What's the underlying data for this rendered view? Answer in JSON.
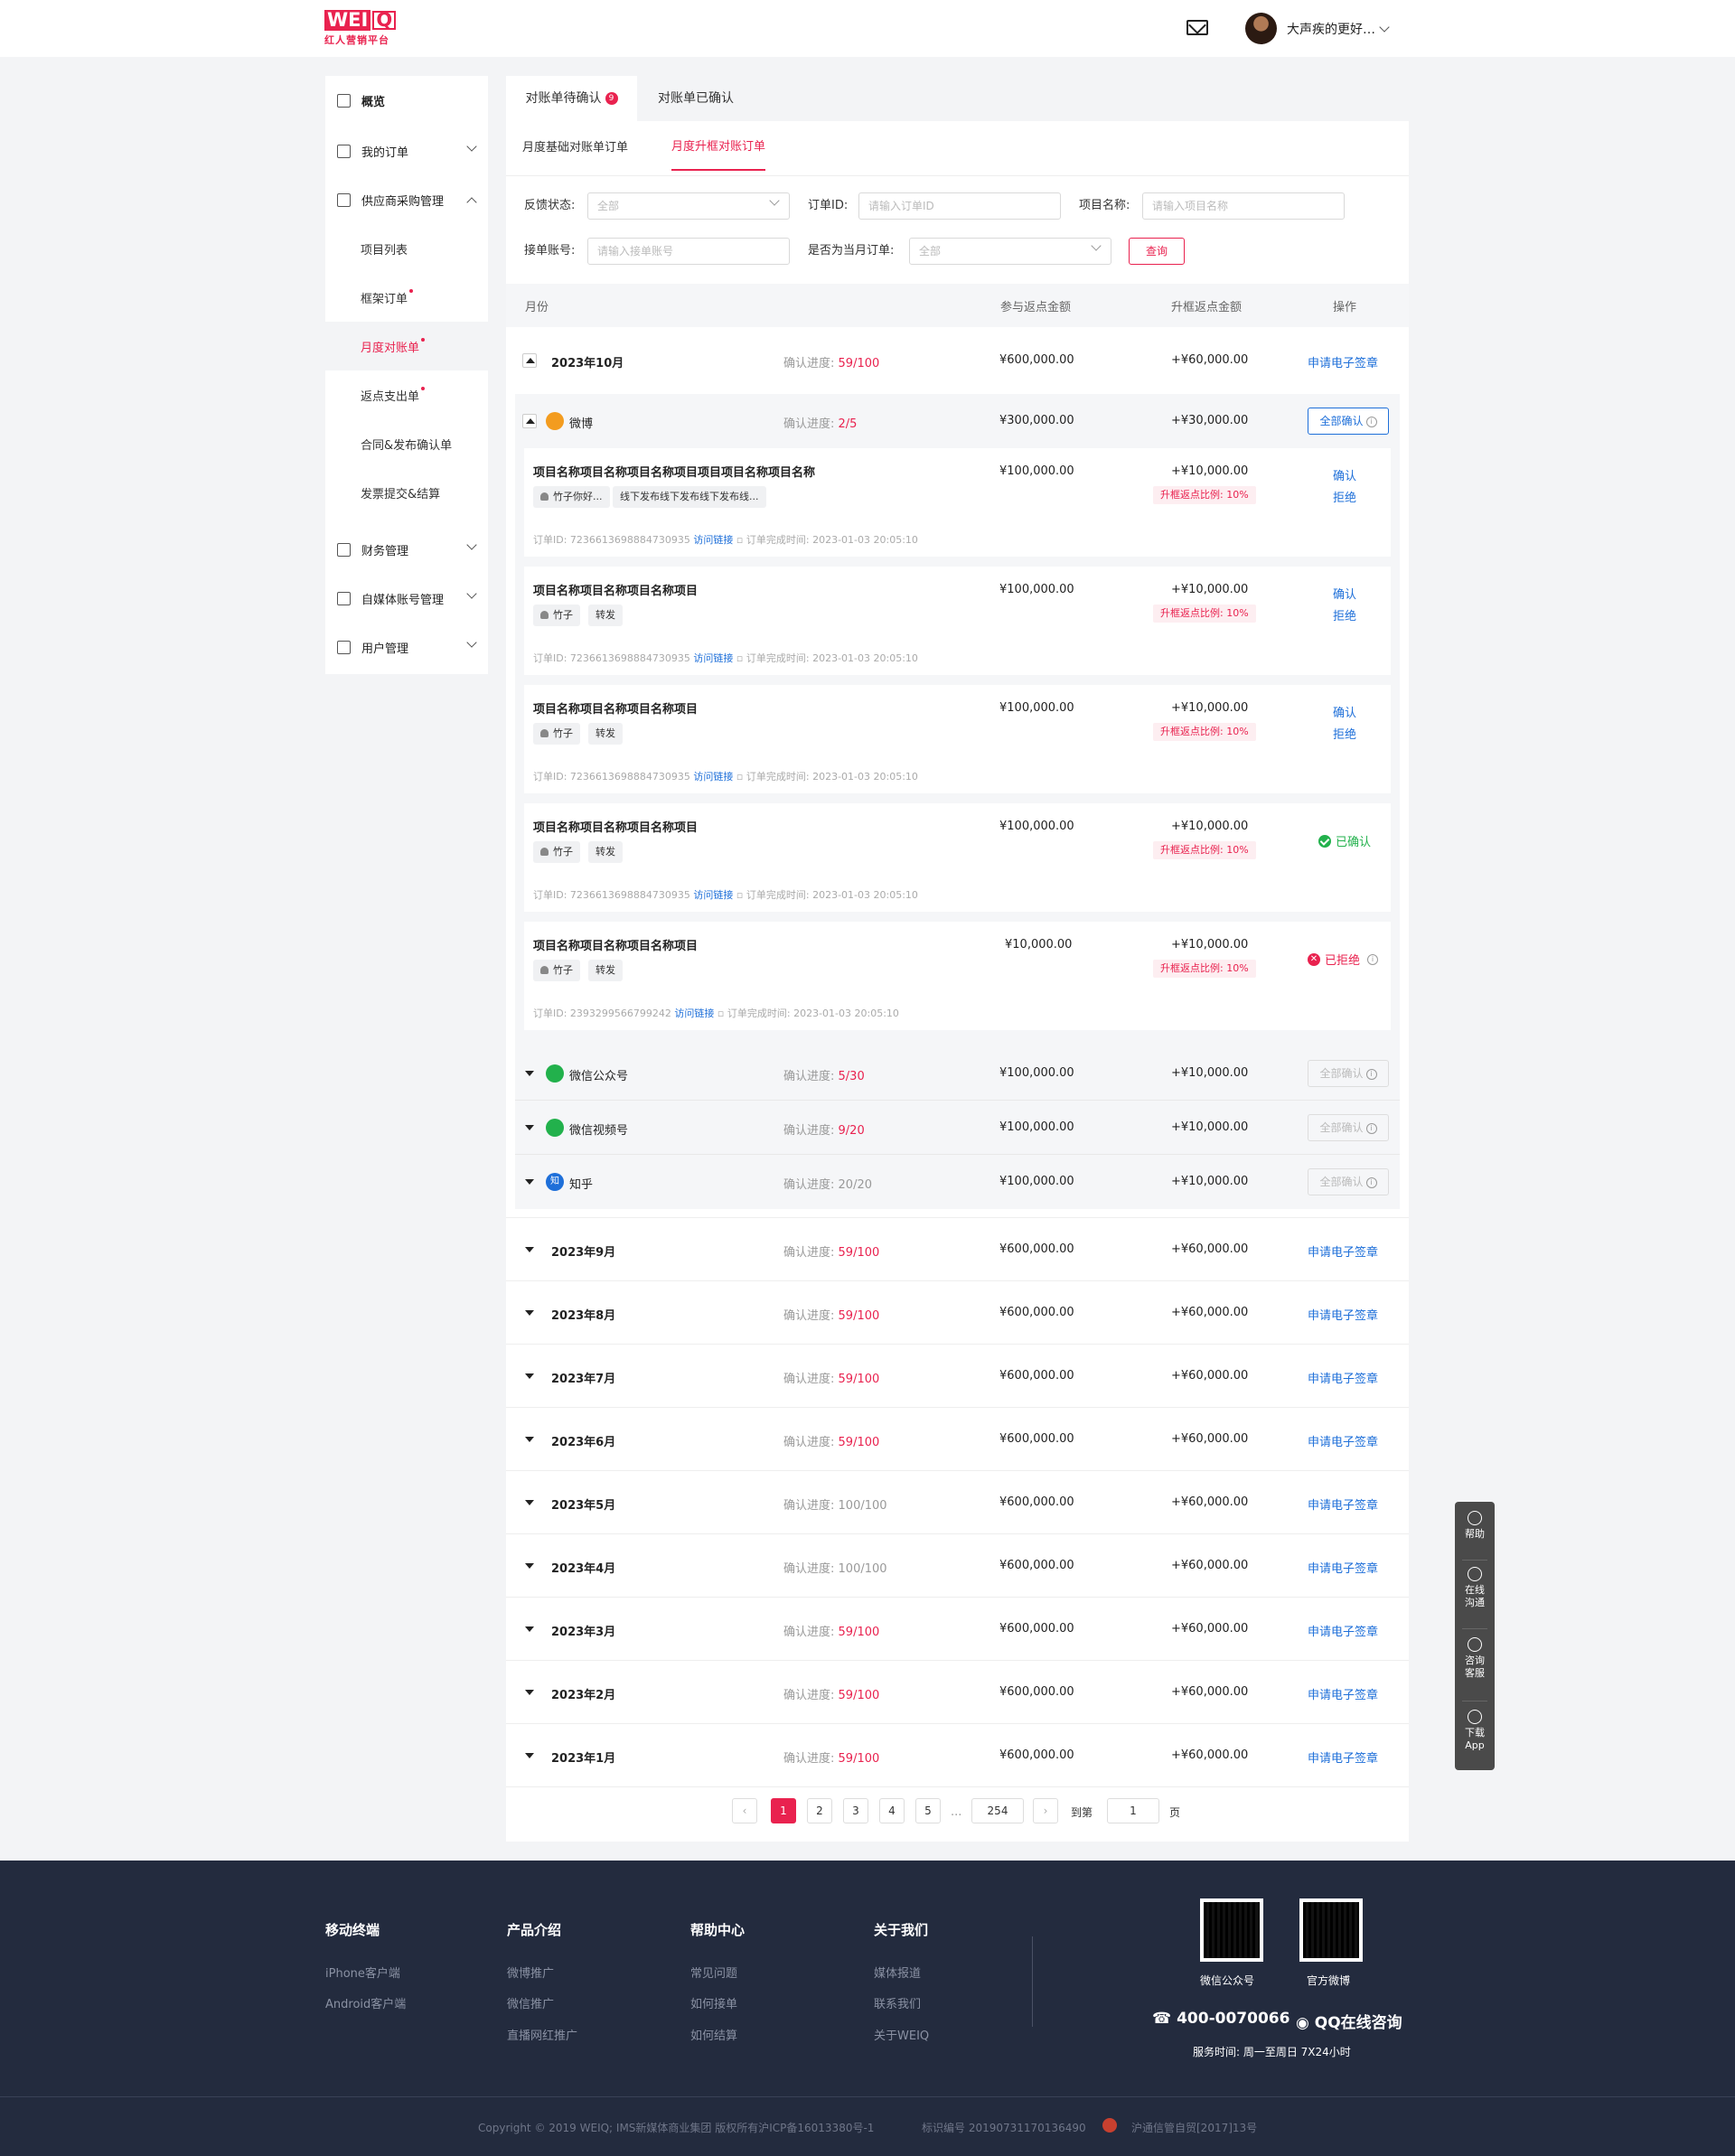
{
  "header": {
    "logo_text": "WEI",
    "logo_q": "Q",
    "logo_sub": "红人营销平台",
    "user_name": "大声疾的更好…"
  },
  "sidebar": {
    "overview": "概览",
    "my_orders": "我的订单",
    "supplier": "供应商采购管理",
    "subs": [
      "项目列表",
      "框架订单",
      "月度对账单",
      "返点支出单",
      "合同&发布确认单",
      "发票提交&结算"
    ],
    "finance": "财务管理",
    "media": "自媒体账号管理",
    "users": "用户管理"
  },
  "tabs": {
    "pending": "对账单待确认",
    "pending_badge": "9",
    "confirmed": "对账单已确认"
  },
  "subtabs": {
    "basic": "月度基础对账单订单",
    "upgrade": "月度升框对账订单"
  },
  "filters": {
    "feedback_label": "反馈状态:",
    "feedback_value": "全部",
    "order_label": "订单ID:",
    "order_ph": "请输入订单ID",
    "project_label": "项目名称:",
    "project_ph": "请输入项目名称",
    "account_label": "接单账号:",
    "account_ph": "请输入接单账号",
    "current_label": "是否为当月订单:",
    "current_value": "全部",
    "query": "查询"
  },
  "table": {
    "col_month": "月份",
    "col_amount": "参与返点金额",
    "col_upgrade": "升框返点金额",
    "col_action": "操作"
  },
  "oct": {
    "month": "2023年10月",
    "progress_label": "确认进度:",
    "progress": "59/100",
    "amount": "¥600,000.00",
    "upgrade": "+¥60,000.00",
    "action": "申请电子签章"
  },
  "weibo": {
    "name": "微博",
    "progress_label": "确认进度:",
    "progress": "2/5",
    "amount": "¥300,000.00",
    "upgrade": "+¥30,000.00",
    "action": "全部确认"
  },
  "items": [
    {
      "title": "项目名称项目名称项目名称项目项目项目名称项目名称",
      "user": "竹子你好...",
      "tag": "线下发布线下发布线下发布线...",
      "id_label": "订单ID:",
      "id": "7236613698884730935",
      "link": "访问链接",
      "time_label": "订单完成时间:",
      "time": "2023-01-03 20:05:10",
      "amount": "¥100,000.00",
      "upgrade": "+¥10,000.00",
      "ratio": "升框返点比例: 10%",
      "confirm": "确认",
      "reject": "拒绝"
    },
    {
      "title": "项目名称项目名称项目名称项目",
      "user": "竹子",
      "tag": "转发",
      "id_label": "订单ID:",
      "id": "7236613698884730935",
      "link": "访问链接",
      "time_label": "订单完成时间:",
      "time": "2023-01-03 20:05:10",
      "amount": "¥100,000.00",
      "upgrade": "+¥10,000.00",
      "ratio": "升框返点比例: 10%",
      "confirm": "确认",
      "reject": "拒绝"
    },
    {
      "title": "项目名称项目名称项目名称项目",
      "user": "竹子",
      "tag": "转发",
      "id_label": "订单ID:",
      "id": "7236613698884730935",
      "link": "访问链接",
      "time_label": "订单完成时间:",
      "time": "2023-01-03 20:05:10",
      "amount": "¥100,000.00",
      "upgrade": "+¥10,000.00",
      "ratio": "升框返点比例: 10%",
      "confirm": "确认",
      "reject": "拒绝"
    },
    {
      "title": "项目名称项目名称项目名称项目",
      "user": "竹子",
      "tag": "转发",
      "id_label": "订单ID:",
      "id": "7236613698884730935",
      "link": "访问链接",
      "time_label": "订单完成时间:",
      "time": "2023-01-03 20:05:10",
      "amount": "¥100,000.00",
      "upgrade": "+¥10,000.00",
      "ratio": "升框返点比例: 10%",
      "status": "已确认"
    },
    {
      "title": "项目名称项目名称项目名称项目",
      "user": "竹子",
      "tag": "转发",
      "id_label": "订单ID:",
      "id": "2393299566799242",
      "link": "访问链接",
      "time_label": "订单完成时间:",
      "time": "2023-01-03 20:05:10",
      "amount": "¥10,000.00",
      "upgrade": "+¥10,000.00",
      "ratio": "升框返点比例: 10%",
      "status": "已拒绝"
    }
  ],
  "groups": [
    {
      "name": "微信公众号",
      "progress_label": "确认进度:",
      "progress": "5/30",
      "amount": "¥100,000.00",
      "upgrade": "+¥10,000.00",
      "action": "全部确认"
    },
    {
      "name": "微信视频号",
      "progress_label": "确认进度:",
      "progress": "9/20",
      "amount": "¥100,000.00",
      "upgrade": "+¥10,000.00",
      "action": "全部确认"
    },
    {
      "name": "知乎",
      "progress_label": "确认进度:",
      "progress": "20/20",
      "amount": "¥100,000.00",
      "upgrade": "+¥10,000.00",
      "action": "全部确认"
    }
  ],
  "zhihu_char": "知",
  "months": [
    {
      "month": "2023年9月",
      "progress_label": "确认进度:",
      "progress": "59/100",
      "amount": "¥600,000.00",
      "upgrade": "+¥60,000.00",
      "action": "申请电子签章"
    },
    {
      "month": "2023年8月",
      "progress_label": "确认进度:",
      "progress": "59/100",
      "amount": "¥600,000.00",
      "upgrade": "+¥60,000.00",
      "action": "申请电子签章"
    },
    {
      "month": "2023年7月",
      "progress_label": "确认进度:",
      "progress": "59/100",
      "amount": "¥600,000.00",
      "upgrade": "+¥60,000.00",
      "action": "申请电子签章"
    },
    {
      "month": "2023年6月",
      "progress_label": "确认进度:",
      "progress": "59/100",
      "amount": "¥600,000.00",
      "upgrade": "+¥60,000.00",
      "action": "申请电子签章"
    },
    {
      "month": "2023年5月",
      "progress_label": "确认进度:",
      "progress": "100/100",
      "amount": "¥600,000.00",
      "upgrade": "+¥60,000.00",
      "action": "申请电子签章"
    },
    {
      "month": "2023年4月",
      "progress_label": "确认进度:",
      "progress": "100/100",
      "amount": "¥600,000.00",
      "upgrade": "+¥60,000.00",
      "action": "申请电子签章"
    },
    {
      "month": "2023年3月",
      "progress_label": "确认进度:",
      "progress": "59/100",
      "amount": "¥600,000.00",
      "upgrade": "+¥60,000.00",
      "action": "申请电子签章"
    },
    {
      "month": "2023年2月",
      "progress_label": "确认进度:",
      "progress": "59/100",
      "amount": "¥600,000.00",
      "upgrade": "+¥60,000.00",
      "action": "申请电子签章"
    },
    {
      "month": "2023年1月",
      "progress_label": "确认进度:",
      "progress": "59/100",
      "amount": "¥600,000.00",
      "upgrade": "+¥60,000.00",
      "action": "申请电子签章"
    }
  ],
  "pager": {
    "pages": [
      "1",
      "2",
      "3",
      "4",
      "5"
    ],
    "ellipsis": "...",
    "last": "254",
    "goto": "到第",
    "input": "1",
    "unit": "页",
    "prev": "‹",
    "next": "›"
  },
  "float": {
    "help": "帮助",
    "chat1": "在线",
    "chat2": "沟通",
    "cs1": "咨询",
    "cs2": "客服",
    "dl1": "下载",
    "dl2": "App"
  },
  "footer": {
    "col1": {
      "title": "移动终端",
      "links": [
        "iPhone客户端",
        "Android客户端"
      ]
    },
    "col2": {
      "title": "产品介绍",
      "links": [
        "微博推广",
        "微信推广",
        "直播网红推广"
      ]
    },
    "col3": {
      "title": "帮助中心",
      "links": [
        "常见问题",
        "如何接单",
        "如何结算"
      ]
    },
    "col4": {
      "title": "关于我们",
      "links": [
        "媒体报道",
        "联系我们",
        "关于WEIQ"
      ]
    },
    "qr1": "微信公众号",
    "qr2": "官方微博",
    "phone": "☎ 400-0070066",
    "qq": "QQ在线咨询",
    "service": "服务时间: 周一至周日 7X24小时",
    "copyright": "Copyright © 2019 WEIQ; IMS新媒体商业集团 版权所有沪ICP备16013380号-1",
    "reg": "标识编号 20190731170136490",
    "license": "沪通信管自贸[2017]13号"
  },
  "colors": {
    "brand": "#e9224f",
    "link": "#1e6fd9",
    "success": "#22b14c"
  }
}
